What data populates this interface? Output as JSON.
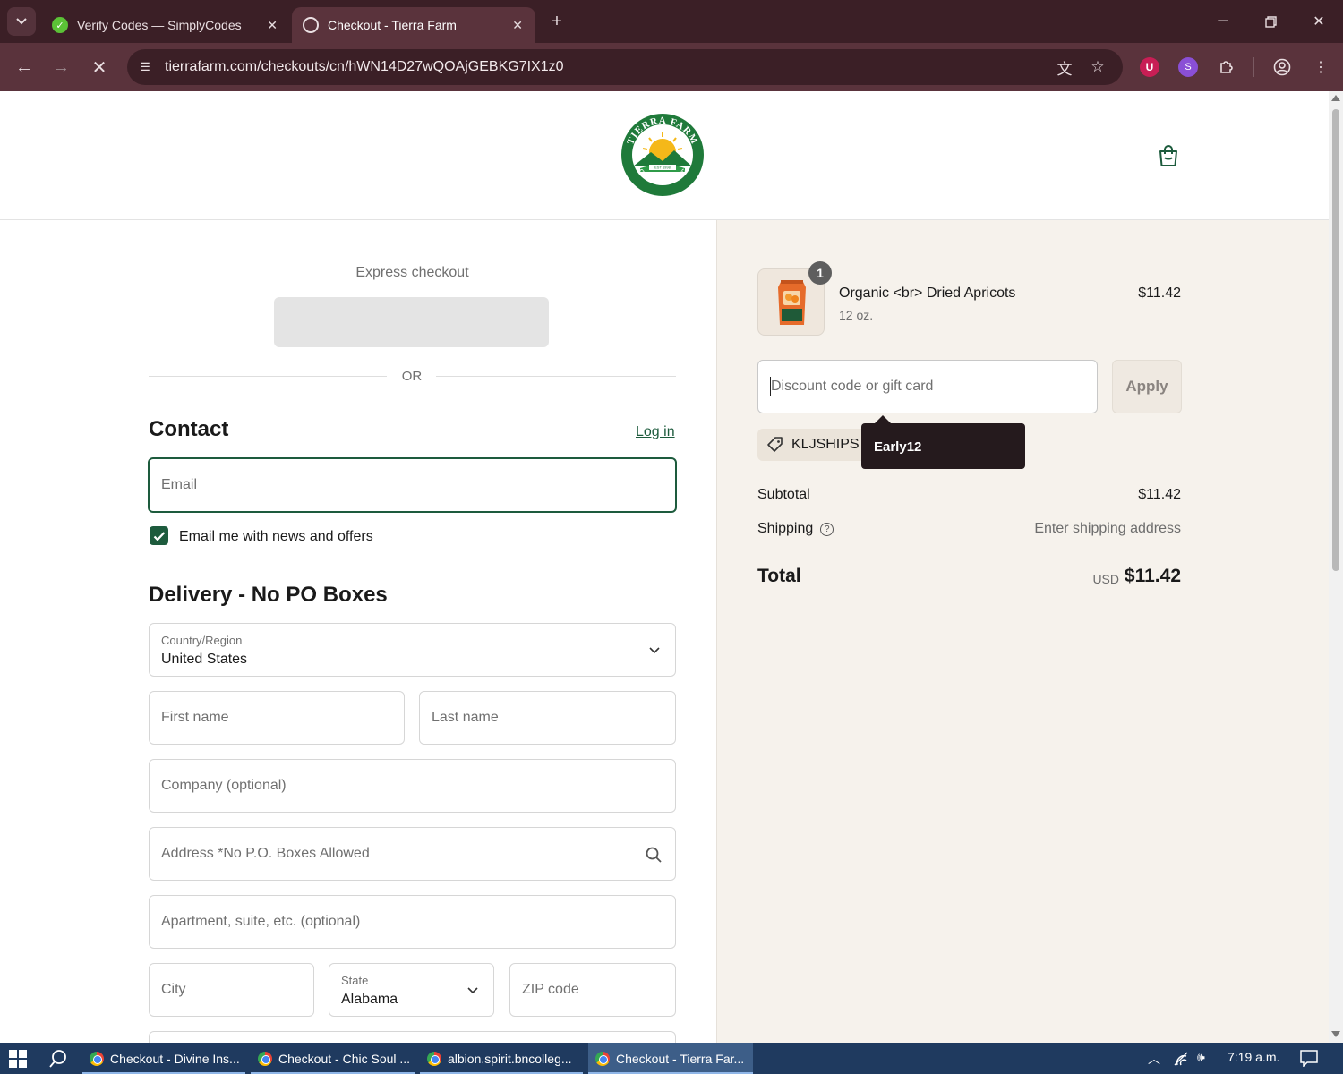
{
  "browser": {
    "tabs": [
      {
        "title": "Verify Codes — SimplyCodes",
        "active": false
      },
      {
        "title": "Checkout - Tierra Farm",
        "active": true
      }
    ],
    "url": "tierrafarm.com/checkouts/cn/hWN14D27wQOAjGEBKG7IX1z0"
  },
  "checkout": {
    "express_label": "Express checkout",
    "or_text": "OR",
    "contact": {
      "heading": "Contact",
      "login_link": "Log in",
      "email_placeholder": "Email",
      "newsletter_label": "Email me with news and offers",
      "newsletter_checked": true
    },
    "delivery": {
      "heading": "Delivery - No PO Boxes",
      "country_label": "Country/Region",
      "country_value": "United States",
      "first_name_placeholder": "First name",
      "last_name_placeholder": "Last name",
      "company_placeholder": "Company (optional)",
      "address_placeholder": "Address *No P.O. Boxes Allowed",
      "apartment_placeholder": "Apartment, suite, etc. (optional)",
      "city_placeholder": "City",
      "state_label": "State",
      "state_value": "Alabama",
      "zip_placeholder": "ZIP code"
    }
  },
  "summary": {
    "item": {
      "name": "Organic <br> Dried Apricots",
      "variant": "12 oz.",
      "price": "$11.42",
      "quantity": "1"
    },
    "discount_placeholder": "Discount code or gift card",
    "apply_label": "Apply",
    "applied_code": "KLJSHIPS",
    "tooltip_text": "Early12",
    "subtotal_label": "Subtotal",
    "subtotal_value": "$11.42",
    "shipping_label": "Shipping",
    "shipping_value": "Enter shipping address",
    "total_label": "Total",
    "total_currency": "USD",
    "total_value": "$11.42"
  },
  "taskbar": {
    "items": [
      "Checkout - Divine Ins...",
      "Checkout - Chic Soul ...",
      "albion.spirit.bncolleg...",
      "Checkout - Tierra Far..."
    ],
    "clock": "7:19 a.m."
  },
  "colors": {
    "brand_green": "#1d5b3d",
    "browser_frame": "#3b1f26",
    "summary_bg": "#f6f2ec",
    "taskbar": "#1f3a5f"
  }
}
